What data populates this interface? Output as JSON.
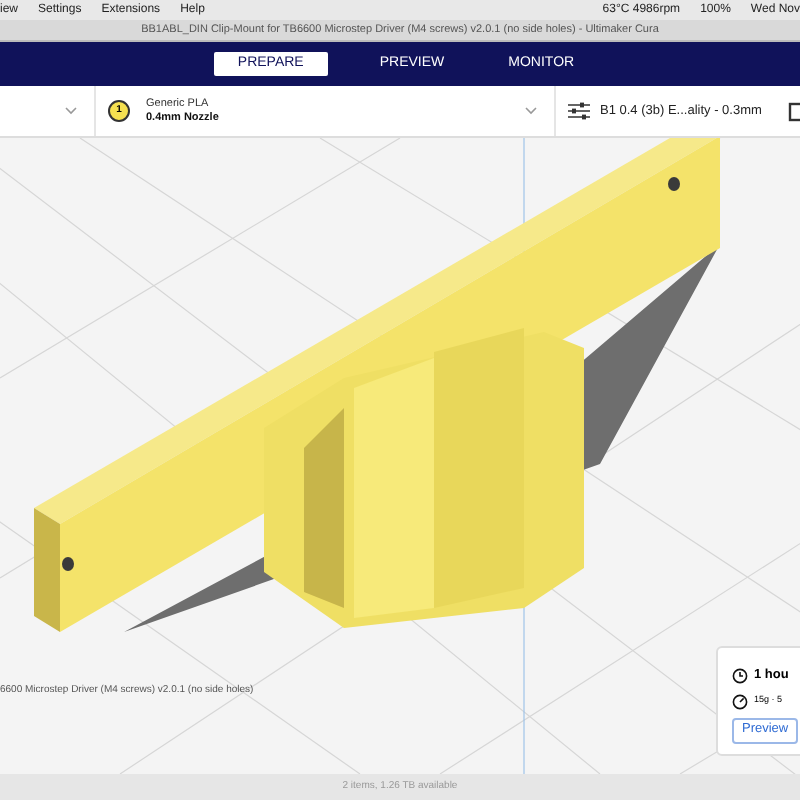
{
  "menu_bar": {
    "items": [
      "iew",
      "Settings",
      "Extensions",
      "Help"
    ],
    "status": [
      "63°C 4986rpm",
      "100%",
      "Wed Nov"
    ]
  },
  "window": {
    "title": "BB1ABL_DIN Clip-Mount for TB6600 Microstep Driver (M4 screws) v2.0.1 (no side holes) - Ultimaker Cura"
  },
  "tabs": [
    {
      "label": "PREPARE",
      "selected": true
    },
    {
      "label": "PREVIEW",
      "selected": false
    },
    {
      "label": "MONITOR",
      "selected": false
    }
  ],
  "toolbar": {
    "extruder": {
      "number": "1",
      "material": "Generic PLA",
      "nozzle": "0.4mm Nozzle"
    },
    "profile": "B1 0.4 (3b) E...ality - 0.3mm"
  },
  "object_name": "6600 Microstep Driver (M4 screws) v2.0.1 (no side holes)",
  "print_card": {
    "time": "1 hou",
    "material": "15g · 5",
    "button": "Preview"
  },
  "status_bar": "2 items, 1.26 TB available"
}
